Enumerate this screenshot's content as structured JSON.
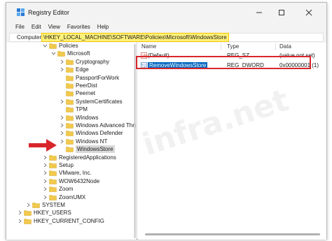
{
  "window": {
    "title": "Registry Editor"
  },
  "menu": [
    "File",
    "Edit",
    "View",
    "Favorites",
    "Help"
  ],
  "address": {
    "prefix": "Computer",
    "path": "\\HKEY_LOCAL_MACHINE\\SOFTWARE\\Policies\\Microsoft\\WindowsStore"
  },
  "tree": [
    {
      "label": "Policies",
      "expanded": true
    },
    {
      "label": "Microsoft",
      "expanded": true
    },
    {
      "label": "Cryptography"
    },
    {
      "label": "Edge"
    },
    {
      "label": "PassportForWork"
    },
    {
      "label": "PeerDist"
    },
    {
      "label": "Peernet"
    },
    {
      "label": "SystemCertificates"
    },
    {
      "label": "TPM"
    },
    {
      "label": "Windows"
    },
    {
      "label": "Windows Advanced Threa"
    },
    {
      "label": "Windows Defender"
    },
    {
      "label": "Windows NT"
    },
    {
      "label": "WindowsStore",
      "selected": true
    },
    {
      "label": "RegisteredApplications"
    },
    {
      "label": "Setup"
    },
    {
      "label": "VMware, Inc."
    },
    {
      "label": "WOW6432Node"
    },
    {
      "label": "Zoom"
    },
    {
      "label": "ZoomUMX"
    },
    {
      "label": "SYSTEM"
    },
    {
      "label": "HKEY_USERS"
    },
    {
      "label": "HKEY_CURRENT_CONFIG"
    }
  ],
  "columns": {
    "name": "Name",
    "type": "Type",
    "data": "Data"
  },
  "values": [
    {
      "name": "(Default)",
      "type": "REG_SZ",
      "data": "(value not set)",
      "icon": "string-value-icon"
    },
    {
      "name": "RemoveWindowsStore",
      "type": "REG_DWORD",
      "data": "0x00000001 (1)",
      "icon": "dword-value-icon",
      "selected": true
    }
  ],
  "watermark": "infra.net",
  "colors": {
    "selection": "#0067c0",
    "highlight": "#fff27a",
    "annotation": "#d8262b",
    "folder": "#f2c94c"
  }
}
